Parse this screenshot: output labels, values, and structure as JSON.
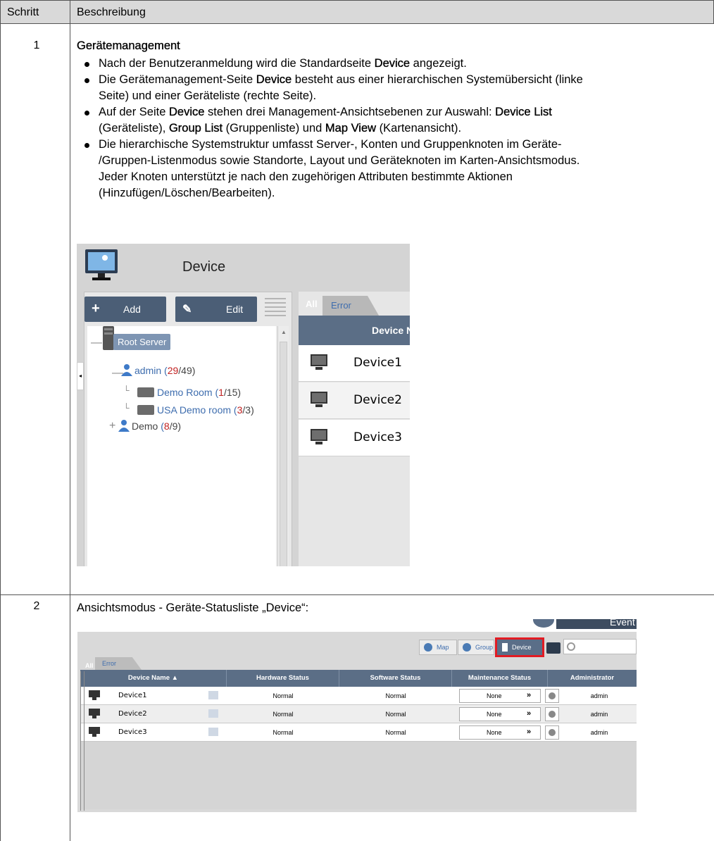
{
  "table": {
    "col_step": "Schritt",
    "col_desc": "Beschreibung"
  },
  "step1": {
    "num": "1",
    "title": "Gerätemanagement",
    "b1_pre": "Nach der Benutzeranmeldung wird die Standardseite ",
    "b1_bold": "Device",
    "b1_post": " angezeigt.",
    "b2_pre": "Die Gerätemanagement-Seite ",
    "b2_bold": "Device",
    "b2_post_l1": " besteht aus einer hierarchischen Systemübersicht (linke",
    "b2_l2": "Seite) und einer Geräteliste (rechte Seite).",
    "b3_pre": "Auf der Seite ",
    "b3_bold1": "Device",
    "b3_mid": " stehen drei Management-Ansichtsebenen zur Auswahl: ",
    "b3_bold2": "Device List",
    "b3_l2_a": "(Geräteliste), ",
    "b3_bold3": "Group List",
    "b3_l2_b": " (Gruppenliste) und ",
    "b3_bold4": "Map View",
    "b3_l2_c": " (Kartenansicht).",
    "b4_l1": "Die hierarchische Systemstruktur umfasst Server-, Konten und Gruppenknoten im Geräte-",
    "b4_l2": "/Gruppen-Listenmodus sowie Standorte, Layout und Geräteknoten im Karten-Ansichtsmodus.",
    "b4_l3": "Jeder Knoten unterstützt je nach den zugehörigen Attributen bestimmte Aktionen",
    "b4_l4": "(Hinzufügen/Löschen/Bearbeiten)."
  },
  "shot1": {
    "title": "Device",
    "add": "Add",
    "edit": "Edit",
    "root": "Root Server",
    "admin": "admin",
    "admin_count_red": "29",
    "admin_count_rest": "/49)",
    "demo_room": "Demo Room",
    "demo_room_red": "1",
    "demo_room_rest": "/15)",
    "usa_room": "USA Demo room",
    "usa_red": "3",
    "usa_rest": "/3)",
    "demo": "Demo",
    "demo_red": "8",
    "demo_rest": "/9)",
    "tab_all": "All",
    "tab_error": "Error",
    "col_name": "Device Nam",
    "devices": [
      "Device1",
      "Device2",
      "Device3"
    ]
  },
  "step2": {
    "num": "2",
    "text": "Ansichtsmodus - Geräte-Statusliste „Device“:"
  },
  "shot2": {
    "event": "Event",
    "tab_all": "All",
    "tab_error": "Error",
    "btn_map": "Map",
    "btn_group": "Group",
    "btn_device": "Device",
    "headers": [
      "Device Name ▲",
      "Hardware Status",
      "Software Status",
      "Maintenance Status",
      "Administrator"
    ],
    "rows": [
      {
        "name": "Device1",
        "hw": "Normal",
        "sw": "Normal",
        "maint": "None",
        "admin": "admin"
      },
      {
        "name": "Device2",
        "hw": "Normal",
        "sw": "Normal",
        "maint": "None",
        "admin": "admin"
      },
      {
        "name": "Device3",
        "hw": "Normal",
        "sw": "Normal",
        "maint": "None",
        "admin": "admin"
      }
    ]
  }
}
